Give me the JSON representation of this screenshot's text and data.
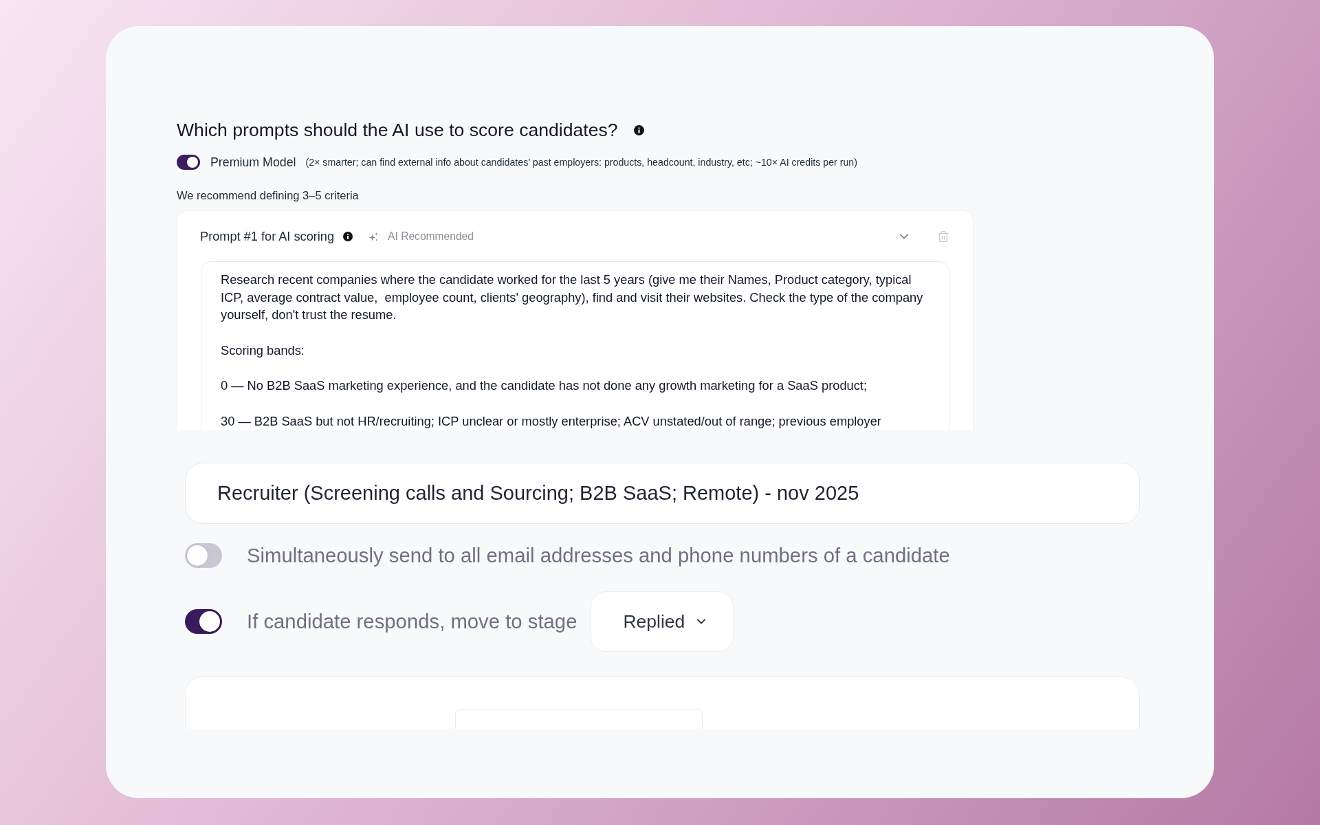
{
  "question": {
    "title": "Which prompts should the AI use to score candidates?"
  },
  "premium_model": {
    "label": "Premium Model",
    "on": true,
    "note": "(2× smarter; can find external info about candidates’ past employers: products, headcount, industry, etc; ~10× AI credits per run)"
  },
  "recommendation": "We recommend defining 3–5 criteria",
  "prompts": [
    {
      "title": "Prompt #1 for AI scoring",
      "badge": "AI Recommended",
      "value": "Research recent companies where the candidate worked for the last 5 years (give me their Names, Product category, typical ICP, average contract value,  employee count, clients' geography), find and visit their websites. Check the type of the company yourself, don't trust the resume.\n\nScoring bands:\n\n0 — No B2B SaaS marketing experience, and the candidate has not done any growth marketing for a SaaS product;\n\n30 — B2B SaaS but not HR/recruiting; ICP unclear or mostly enterprise; ACV unstated/out of range; previous employer"
    }
  ],
  "job_title_field": {
    "value": "Recruiter (Screening calls and Sourcing; B2B SaaS; Remote) - nov 2025"
  },
  "options": [
    {
      "kind": "toggle",
      "label": "Simultaneously send to all email addresses and phone numbers of a candidate",
      "on": false
    },
    {
      "kind": "toggle-select",
      "label": "If candidate responds, move to stage",
      "on": true,
      "select": {
        "value": "Replied"
      }
    }
  ]
}
